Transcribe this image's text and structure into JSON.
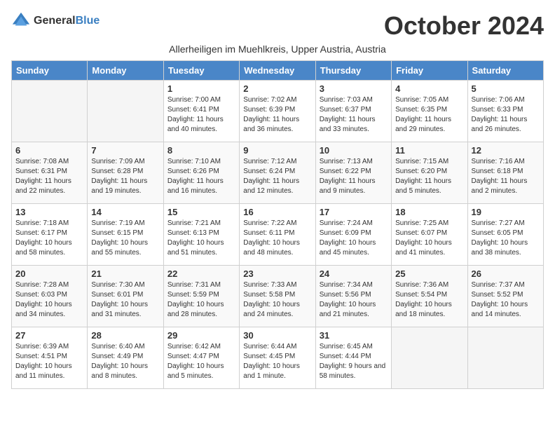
{
  "header": {
    "logo_general": "General",
    "logo_blue": "Blue",
    "month_title": "October 2024",
    "subtitle": "Allerheiligen im Muehlkreis, Upper Austria, Austria"
  },
  "days_of_week": [
    "Sunday",
    "Monday",
    "Tuesday",
    "Wednesday",
    "Thursday",
    "Friday",
    "Saturday"
  ],
  "weeks": [
    [
      {
        "day": "",
        "empty": true
      },
      {
        "day": "",
        "empty": true
      },
      {
        "day": "1",
        "sunrise": "Sunrise: 7:00 AM",
        "sunset": "Sunset: 6:41 PM",
        "daylight": "Daylight: 11 hours and 40 minutes."
      },
      {
        "day": "2",
        "sunrise": "Sunrise: 7:02 AM",
        "sunset": "Sunset: 6:39 PM",
        "daylight": "Daylight: 11 hours and 36 minutes."
      },
      {
        "day": "3",
        "sunrise": "Sunrise: 7:03 AM",
        "sunset": "Sunset: 6:37 PM",
        "daylight": "Daylight: 11 hours and 33 minutes."
      },
      {
        "day": "4",
        "sunrise": "Sunrise: 7:05 AM",
        "sunset": "Sunset: 6:35 PM",
        "daylight": "Daylight: 11 hours and 29 minutes."
      },
      {
        "day": "5",
        "sunrise": "Sunrise: 7:06 AM",
        "sunset": "Sunset: 6:33 PM",
        "daylight": "Daylight: 11 hours and 26 minutes."
      }
    ],
    [
      {
        "day": "6",
        "sunrise": "Sunrise: 7:08 AM",
        "sunset": "Sunset: 6:31 PM",
        "daylight": "Daylight: 11 hours and 22 minutes."
      },
      {
        "day": "7",
        "sunrise": "Sunrise: 7:09 AM",
        "sunset": "Sunset: 6:28 PM",
        "daylight": "Daylight: 11 hours and 19 minutes."
      },
      {
        "day": "8",
        "sunrise": "Sunrise: 7:10 AM",
        "sunset": "Sunset: 6:26 PM",
        "daylight": "Daylight: 11 hours and 16 minutes."
      },
      {
        "day": "9",
        "sunrise": "Sunrise: 7:12 AM",
        "sunset": "Sunset: 6:24 PM",
        "daylight": "Daylight: 11 hours and 12 minutes."
      },
      {
        "day": "10",
        "sunrise": "Sunrise: 7:13 AM",
        "sunset": "Sunset: 6:22 PM",
        "daylight": "Daylight: 11 hours and 9 minutes."
      },
      {
        "day": "11",
        "sunrise": "Sunrise: 7:15 AM",
        "sunset": "Sunset: 6:20 PM",
        "daylight": "Daylight: 11 hours and 5 minutes."
      },
      {
        "day": "12",
        "sunrise": "Sunrise: 7:16 AM",
        "sunset": "Sunset: 6:18 PM",
        "daylight": "Daylight: 11 hours and 2 minutes."
      }
    ],
    [
      {
        "day": "13",
        "sunrise": "Sunrise: 7:18 AM",
        "sunset": "Sunset: 6:17 PM",
        "daylight": "Daylight: 10 hours and 58 minutes."
      },
      {
        "day": "14",
        "sunrise": "Sunrise: 7:19 AM",
        "sunset": "Sunset: 6:15 PM",
        "daylight": "Daylight: 10 hours and 55 minutes."
      },
      {
        "day": "15",
        "sunrise": "Sunrise: 7:21 AM",
        "sunset": "Sunset: 6:13 PM",
        "daylight": "Daylight: 10 hours and 51 minutes."
      },
      {
        "day": "16",
        "sunrise": "Sunrise: 7:22 AM",
        "sunset": "Sunset: 6:11 PM",
        "daylight": "Daylight: 10 hours and 48 minutes."
      },
      {
        "day": "17",
        "sunrise": "Sunrise: 7:24 AM",
        "sunset": "Sunset: 6:09 PM",
        "daylight": "Daylight: 10 hours and 45 minutes."
      },
      {
        "day": "18",
        "sunrise": "Sunrise: 7:25 AM",
        "sunset": "Sunset: 6:07 PM",
        "daylight": "Daylight: 10 hours and 41 minutes."
      },
      {
        "day": "19",
        "sunrise": "Sunrise: 7:27 AM",
        "sunset": "Sunset: 6:05 PM",
        "daylight": "Daylight: 10 hours and 38 minutes."
      }
    ],
    [
      {
        "day": "20",
        "sunrise": "Sunrise: 7:28 AM",
        "sunset": "Sunset: 6:03 PM",
        "daylight": "Daylight: 10 hours and 34 minutes."
      },
      {
        "day": "21",
        "sunrise": "Sunrise: 7:30 AM",
        "sunset": "Sunset: 6:01 PM",
        "daylight": "Daylight: 10 hours and 31 minutes."
      },
      {
        "day": "22",
        "sunrise": "Sunrise: 7:31 AM",
        "sunset": "Sunset: 5:59 PM",
        "daylight": "Daylight: 10 hours and 28 minutes."
      },
      {
        "day": "23",
        "sunrise": "Sunrise: 7:33 AM",
        "sunset": "Sunset: 5:58 PM",
        "daylight": "Daylight: 10 hours and 24 minutes."
      },
      {
        "day": "24",
        "sunrise": "Sunrise: 7:34 AM",
        "sunset": "Sunset: 5:56 PM",
        "daylight": "Daylight: 10 hours and 21 minutes."
      },
      {
        "day": "25",
        "sunrise": "Sunrise: 7:36 AM",
        "sunset": "Sunset: 5:54 PM",
        "daylight": "Daylight: 10 hours and 18 minutes."
      },
      {
        "day": "26",
        "sunrise": "Sunrise: 7:37 AM",
        "sunset": "Sunset: 5:52 PM",
        "daylight": "Daylight: 10 hours and 14 minutes."
      }
    ],
    [
      {
        "day": "27",
        "sunrise": "Sunrise: 6:39 AM",
        "sunset": "Sunset: 4:51 PM",
        "daylight": "Daylight: 10 hours and 11 minutes."
      },
      {
        "day": "28",
        "sunrise": "Sunrise: 6:40 AM",
        "sunset": "Sunset: 4:49 PM",
        "daylight": "Daylight: 10 hours and 8 minutes."
      },
      {
        "day": "29",
        "sunrise": "Sunrise: 6:42 AM",
        "sunset": "Sunset: 4:47 PM",
        "daylight": "Daylight: 10 hours and 5 minutes."
      },
      {
        "day": "30",
        "sunrise": "Sunrise: 6:44 AM",
        "sunset": "Sunset: 4:45 PM",
        "daylight": "Daylight: 10 hours and 1 minute."
      },
      {
        "day": "31",
        "sunrise": "Sunrise: 6:45 AM",
        "sunset": "Sunset: 4:44 PM",
        "daylight": "Daylight: 9 hours and 58 minutes."
      },
      {
        "day": "",
        "empty": true
      },
      {
        "day": "",
        "empty": true
      }
    ]
  ]
}
